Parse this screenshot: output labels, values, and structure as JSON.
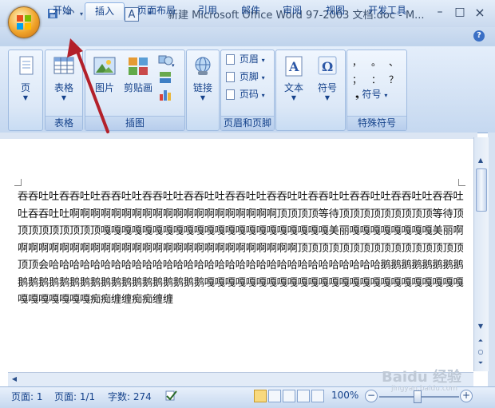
{
  "window": {
    "title": "新建 Microsoft Office Word 97-2003 文档.doc - M...",
    "controls": {
      "minimize": "–",
      "maximize": "□",
      "close": "×"
    }
  },
  "quick_access": {
    "icons": [
      "save-icon",
      "undo-icon",
      "redo-icon",
      "print-preview-icon",
      "format-icon"
    ]
  },
  "tabs": [
    {
      "label": "开始",
      "active": false
    },
    {
      "label": "插入",
      "active": true
    },
    {
      "label": "页面布局",
      "active": false
    },
    {
      "label": "引用",
      "active": false
    },
    {
      "label": "邮件",
      "active": false
    },
    {
      "label": "审阅",
      "active": false
    },
    {
      "label": "视图",
      "active": false
    },
    {
      "label": "开发工具",
      "active": false
    }
  ],
  "help": "?",
  "ribbon": {
    "groups": [
      {
        "label": "",
        "buttons": [
          {
            "label": "页"
          }
        ]
      },
      {
        "label": "表格",
        "buttons": [
          {
            "label": "表格"
          }
        ]
      },
      {
        "label": "插图",
        "buttons": [
          {
            "label": "图片"
          },
          {
            "label": "剪贴画"
          }
        ]
      },
      {
        "label": "",
        "buttons": [
          {
            "label": "链接"
          }
        ]
      },
      {
        "label": "页眉和页脚",
        "buttons": [
          {
            "label": "页眉"
          },
          {
            "label": "页脚"
          },
          {
            "label": "页码"
          }
        ]
      },
      {
        "label": "",
        "buttons": [
          {
            "label": "文本"
          },
          {
            "label": "符号"
          }
        ]
      },
      {
        "label": "特殊符号",
        "buttons": [
          {
            "label": "符号"
          }
        ],
        "glyphs": [
          "，",
          "。",
          "、",
          "；",
          "：",
          "？"
        ]
      }
    ]
  },
  "document": {
    "text": "吞吞吐吐吞吞吐吐吞吞吐吐吞吞吐吐吞吞吐吐吞吞吐吐吞吞吐吐吞吞吐吐吞吞吐吐吞吞吐吐吞吞吐吐吞吞吐吐啊啊啊啊啊啊啊啊啊啊啊啊啊啊啊啊啊啊啊啊顶顶顶顶等待顶顶顶顶顶顶顶顶顶等待顶顶顶顶顶顶顶顶顶嘎嘎嘎嘎嘎嘎嘎嘎嘎嘎嘎嘎嘎嘎嘎嘎嘎嘎嘎嘎嘎嘎美丽嘎嘎嘎嘎嘎嘎嘎嘎美丽啊啊啊啊啊啊啊啊啊啊啊啊啊啊啊啊啊啊啊啊啊啊啊啊啊啊啊啊顶顶顶顶顶顶顶顶顶顶顶顶顶顶顶顶顶顶会哈哈哈哈哈哈哈哈哈哈哈哈哈哈哈哈哈哈哈哈哈哈哈哈哈哈哈哈哈哈哈哈鹅鹅鹅鹅鹅鹅鹅鹅鹅鹅鹅鹅鹅鹅鹅鹅鹅鹅鹅鹅鹅鹅鹅鹅鹅鹅嘎嘎嘎嘎嘎嘎嘎嘎嘎嘎嘎嘎嘎嘎嘎嘎嘎嘎嘎嘎嘎嘎嘎嘎嘎嘎嘎嘎嘎嘎嘎嘎痴痴缠缠痴痴缠缠"
  },
  "statusbar": {
    "page": "页面: 1",
    "pages": "页面: 1/1",
    "words": "字数: 274",
    "zoom": "100%",
    "zoom_level": 1.0
  },
  "watermark": {
    "brand": "Baidu 经验",
    "url": "jingyan.baidu.com"
  },
  "colors": {
    "accent": "#15428b",
    "ribbon": "#dce8f7",
    "arrow": "#b3202a"
  }
}
